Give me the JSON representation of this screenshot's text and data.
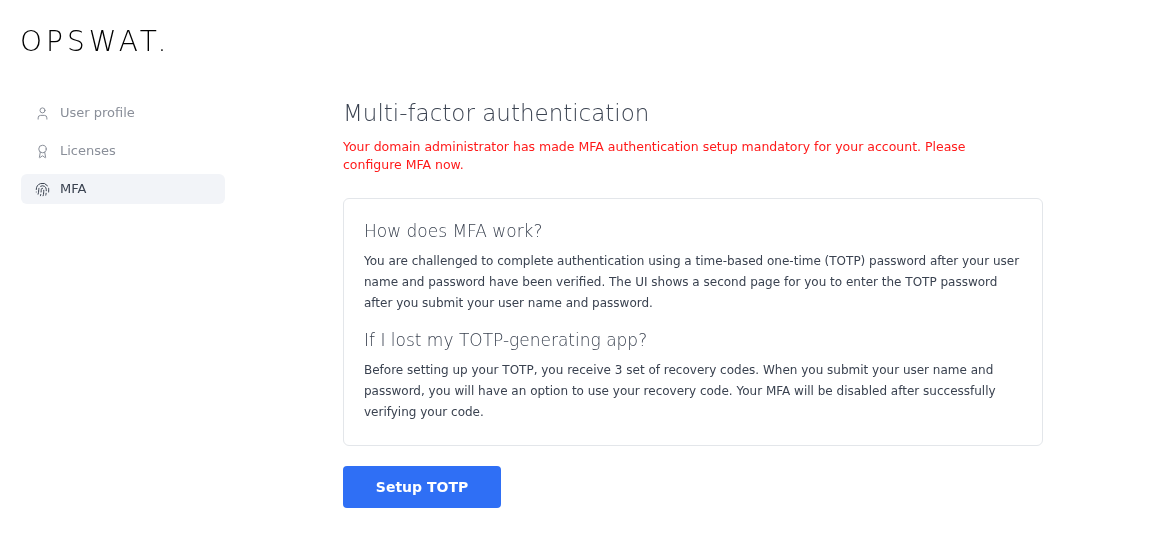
{
  "logo": "OPSWAT.",
  "sidebar": {
    "items": [
      {
        "label": "User profile",
        "kind": "user",
        "selected": false
      },
      {
        "label": "Licenses",
        "kind": "award",
        "selected": false
      },
      {
        "label": "MFA",
        "kind": "fingerprint",
        "selected": true
      }
    ]
  },
  "page": {
    "title": "Multi-factor authentication",
    "warning": "Your domain administrator has made MFA authentication setup mandatory for your account. Please configure MFA now.",
    "sections": [
      {
        "heading": "How does MFA work?",
        "text": "You are challenged to complete authentication using a time-based one-time (TOTP) password after your user name and password have been verified. The UI shows a second page for you to enter the TOTP password after you submit your user name and password."
      },
      {
        "heading": "If I lost my TOTP-generating app?",
        "text": "Before setting up your TOTP, you receive 3 set of recovery codes. When you submit your user name and password, you will have an option to use your recovery code. Your MFA will be disabled after successfully verifying your code."
      }
    ],
    "button": "Setup TOTP"
  }
}
